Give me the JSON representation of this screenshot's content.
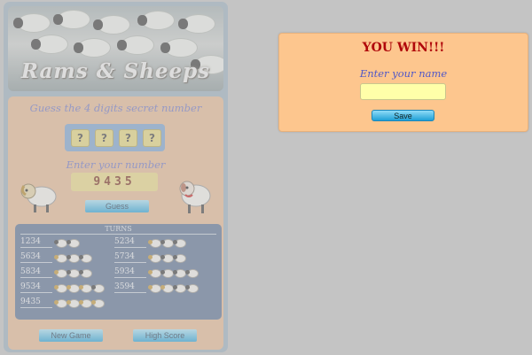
{
  "game": {
    "banner_title": "Rams & Sheeps",
    "subtitle": "Guess the 4 digits secret number",
    "secret_digits": [
      "?",
      "?",
      "?",
      "?"
    ],
    "enter_label": "Enter your number",
    "number_value": "9435",
    "guess_button": "Guess",
    "turns_header": "TURNS",
    "turns": [
      {
        "number": "1234",
        "rams": 0,
        "sheeps": 2
      },
      {
        "number": "5634",
        "rams": 1,
        "sheeps": 2
      },
      {
        "number": "5834",
        "rams": 1,
        "sheeps": 2
      },
      {
        "number": "9534",
        "rams": 3,
        "sheeps": 1
      },
      {
        "number": "9435",
        "rams": 4,
        "sheeps": 0
      },
      {
        "number": "5234",
        "rams": 1,
        "sheeps": 2
      },
      {
        "number": "5734",
        "rams": 1,
        "sheeps": 2
      },
      {
        "number": "5934",
        "rams": 1,
        "sheeps": 3
      },
      {
        "number": "3594",
        "rams": 2,
        "sheeps": 2
      }
    ],
    "new_game_button": "New Game",
    "high_score_button": "High Score"
  },
  "dialog": {
    "title": "YOU WIN!!!",
    "name_label": "Enter your name",
    "name_value": "",
    "save_button": "Save"
  },
  "colors": {
    "win_title": "#b0080b",
    "dialog_bg": "#fdc68e",
    "name_input_bg": "#ffffa9",
    "button_blue": "#2aa6dc"
  }
}
